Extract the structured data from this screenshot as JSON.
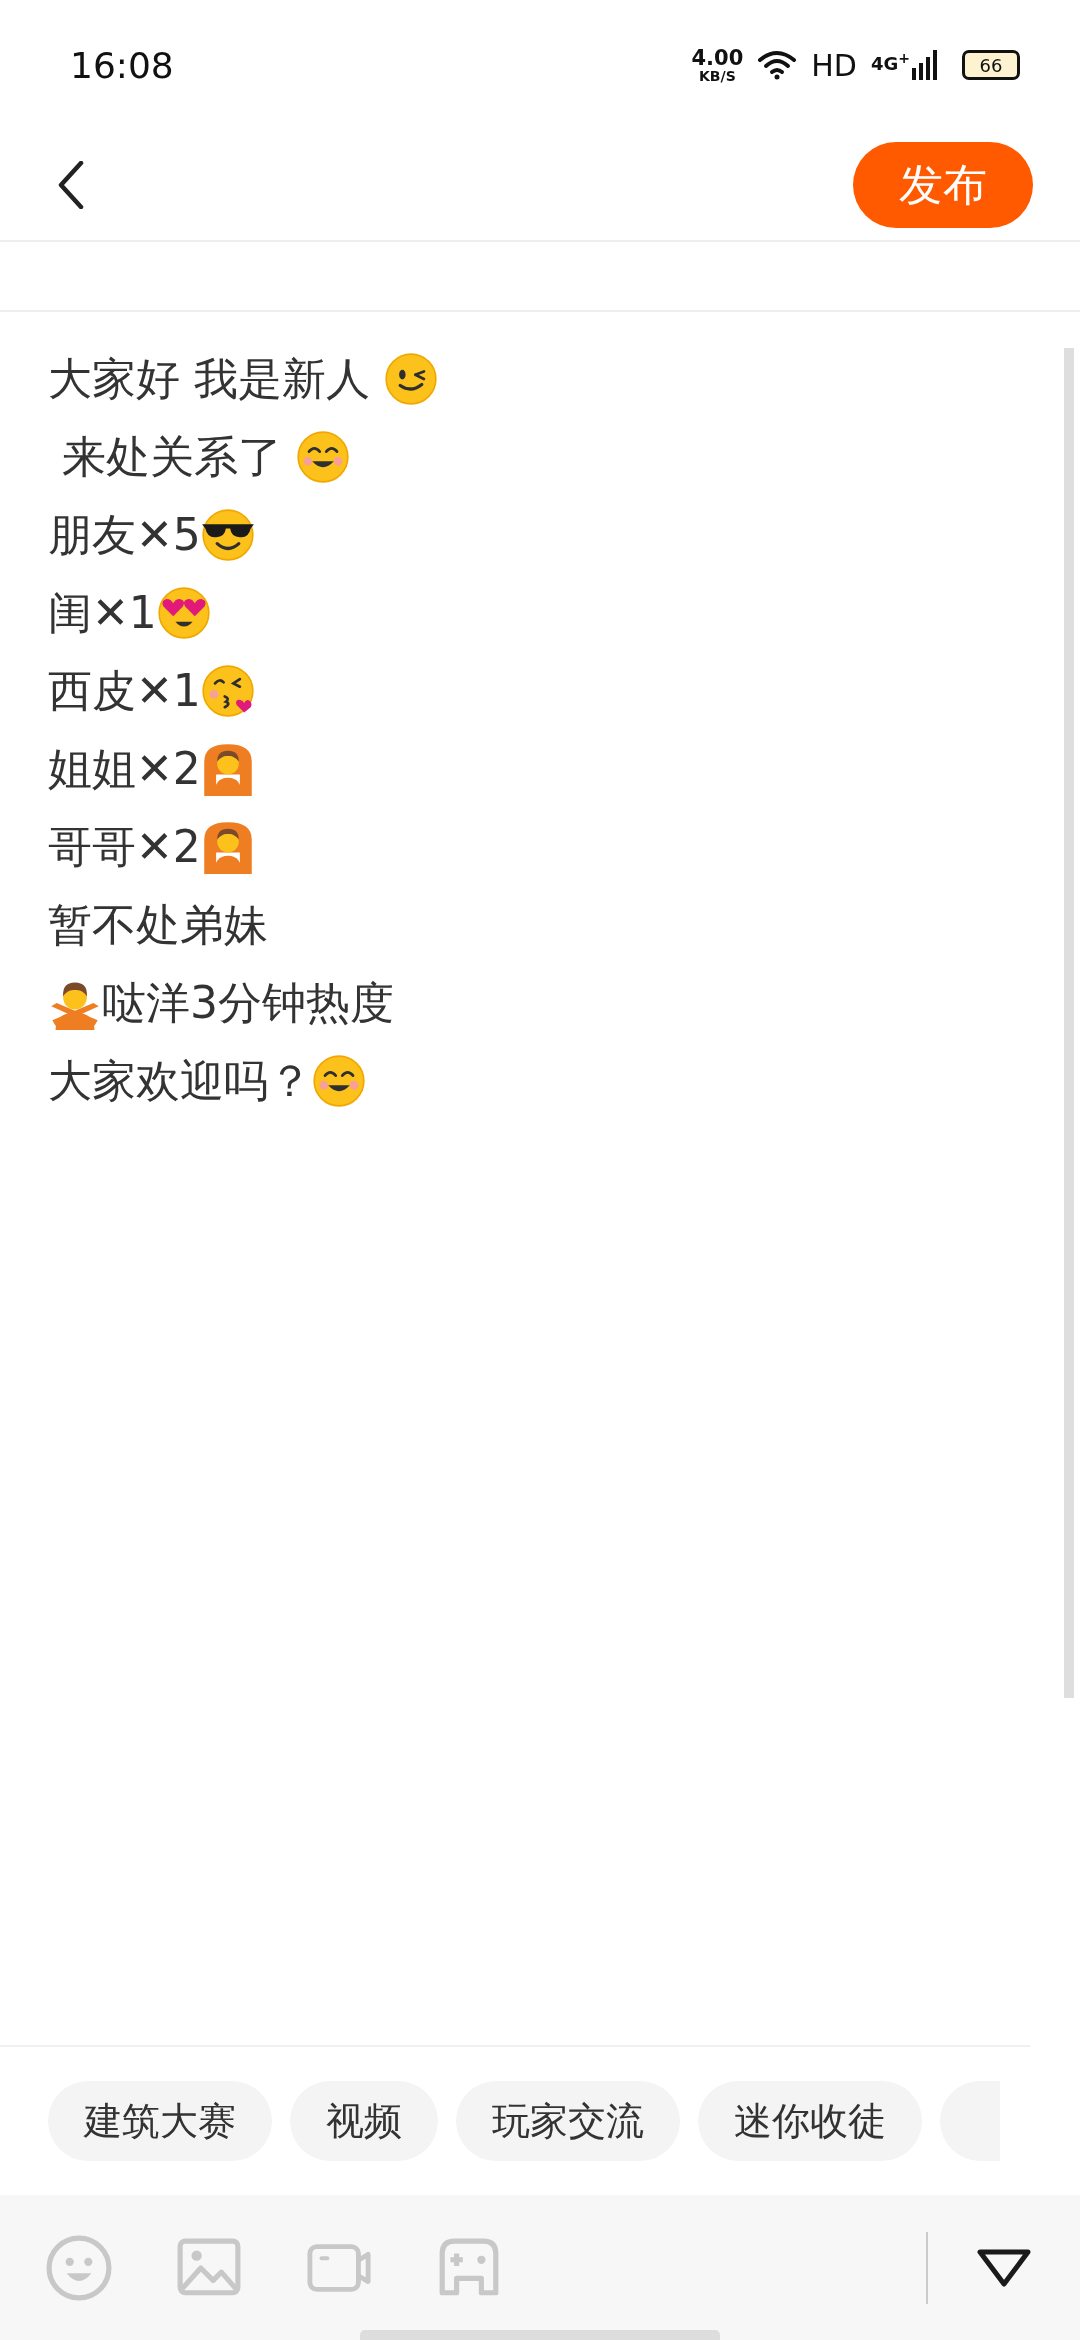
{
  "status_bar": {
    "time": "16:08",
    "speed_value": "4.00",
    "speed_unit": "KB/S",
    "hd_label": "HD",
    "network_type": "4G",
    "network_plus": "+",
    "battery": "66"
  },
  "header": {
    "publish_button": "发布"
  },
  "lines": [
    {
      "parts": [
        {
          "kind": "text",
          "text": "大家好 我是新人 "
        },
        {
          "kind": "wink"
        }
      ]
    },
    {
      "parts": [
        {
          "kind": "text",
          "text": " 来处关系了 "
        },
        {
          "kind": "blush"
        }
      ]
    },
    {
      "parts": [
        {
          "kind": "text",
          "text": "朋友✕5"
        },
        {
          "kind": "sunglasses"
        }
      ]
    },
    {
      "parts": [
        {
          "kind": "text",
          "text": "闺✕1"
        },
        {
          "kind": "heart-eyes"
        }
      ]
    },
    {
      "parts": [
        {
          "kind": "text",
          "text": "西皮✕1"
        },
        {
          "kind": "kiss"
        }
      ]
    },
    {
      "parts": [
        {
          "kind": "text",
          "text": "姐姐✕2"
        },
        {
          "kind": "arms-up"
        }
      ]
    },
    {
      "parts": [
        {
          "kind": "text",
          "text": "哥哥✕2"
        },
        {
          "kind": "arms-up"
        }
      ]
    },
    {
      "parts": [
        {
          "kind": "text",
          "text": "暂不处弟妹"
        }
      ]
    },
    {
      "parts": [
        {
          "kind": "arms-crossed"
        },
        {
          "kind": "text",
          "text": "哒洋3分钟热度"
        }
      ]
    },
    {
      "parts": [
        {
          "kind": "text",
          "text": "大家欢迎吗？"
        },
        {
          "kind": "blush"
        }
      ]
    }
  ],
  "tags": [
    {
      "label": "建筑大赛"
    },
    {
      "label": "视频"
    },
    {
      "label": "玩家交流"
    },
    {
      "label": "迷你收徒"
    }
  ]
}
